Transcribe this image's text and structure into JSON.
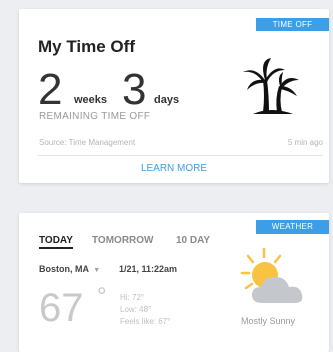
{
  "timeoff": {
    "tag": "TIME OFF",
    "title": "My Time Off",
    "weeks_value": "2",
    "weeks_unit": "weeks",
    "days_value": "3",
    "days_unit": "days",
    "subtitle": "REMAINING TIME OFF",
    "source": "Source: Time Management",
    "updated": "5 min ago",
    "learn_more": "LEARN MORE"
  },
  "weather": {
    "tag": "WEATHER",
    "tabs": [
      "TODAY",
      "TOMORROW",
      "10 DAY"
    ],
    "location": "Boston, MA",
    "datetime": "1/21, 11:22am",
    "temperature": "67",
    "degree_symbol": "°",
    "high": "Hi: 72°",
    "low": "Low: 48°",
    "feels_like": "Feels like: 67°",
    "condition": "Mostly Sunny",
    "icon": "partly-sunny-icon"
  },
  "colors": {
    "accent": "#3b9ee6",
    "sun": "#f6c343",
    "cloud": "#c4c8cc"
  }
}
